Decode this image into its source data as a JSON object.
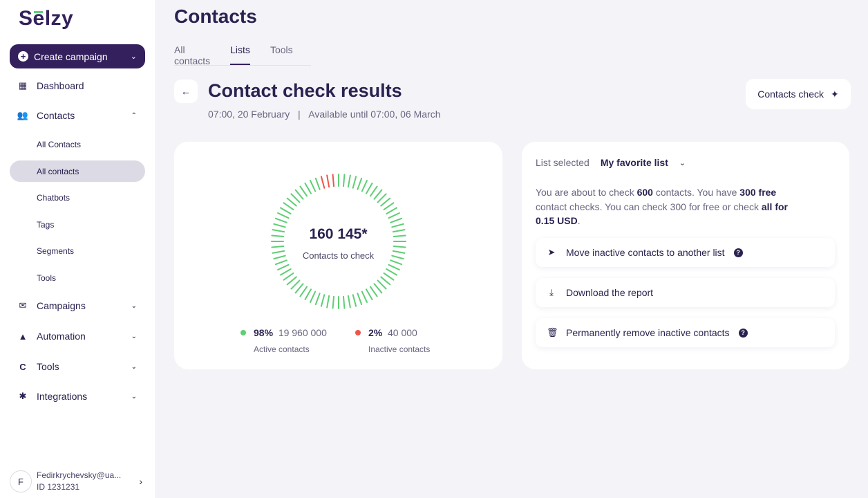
{
  "brand": {
    "logo": "Selzy"
  },
  "sidebar": {
    "create_label": "Create campaign",
    "items": [
      {
        "label": "Dashboard",
        "icon": "grid-icon"
      },
      {
        "label": "Contacts",
        "icon": "users-icon"
      },
      {
        "label": "Campaigns",
        "icon": "mail-icon"
      },
      {
        "label": "Automation",
        "icon": "flow-icon"
      },
      {
        "label": "Tools",
        "icon": "tools-icon"
      },
      {
        "label": "Integrations",
        "icon": "puzzle-icon"
      }
    ],
    "contacts_sub": [
      "All Contacts",
      "All contacts",
      "Chatbots",
      "Tags",
      "Segments",
      "Tools"
    ],
    "user": {
      "initial": "F",
      "email": "Fedirkrychevsky@ua...",
      "id": "ID 1231231"
    }
  },
  "page": {
    "title": "Contacts",
    "tabs": [
      "All contacts",
      "Lists",
      "Tools"
    ],
    "active_tab": "Lists"
  },
  "results": {
    "title": "Contact check results",
    "date": "07:00, 20 February",
    "separator": "|",
    "available": "Available until 07:00, 06 March",
    "check_button": "Contacts check",
    "total": "160 145*",
    "total_label": "Contacts to check",
    "active": {
      "pct": "98%",
      "count": "19 960 000",
      "label": "Active contacts",
      "color": "#5fce74",
      "fraction": 0.98
    },
    "inactive": {
      "pct": "2%",
      "count": "40 000",
      "label": "Inactive contacts",
      "color": "#f0544a",
      "fraction": 0.02
    }
  },
  "panel": {
    "list_label": "List selected",
    "list_value": "My favorite list",
    "desc": {
      "p1": "You are about to check ",
      "n1": "600",
      "p2": " contacts. You have ",
      "n2": "300 free",
      "p3": " contact checks. You can check 300 for free or check ",
      "n3": "all for 0.15 USD",
      "p4": "."
    },
    "actions": [
      {
        "label": "Move inactive contacts to another list",
        "icon": "send-icon",
        "help": true
      },
      {
        "label": "Download the report",
        "icon": "download-icon",
        "help": false
      },
      {
        "label": "Permanently remove inactive contacts",
        "icon": "trash-icon",
        "help": true
      }
    ]
  }
}
